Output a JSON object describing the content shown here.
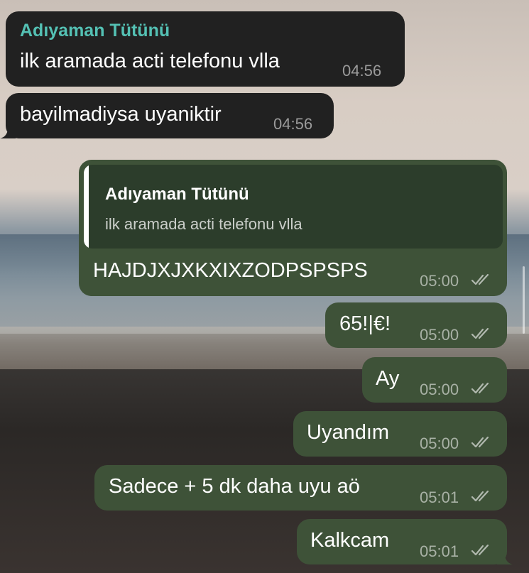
{
  "colors": {
    "incoming_bubble": "#212121",
    "outgoing_bubble": "#3e5238",
    "sender_name": "#54c1b4",
    "reply_quote": "#2c3d2b"
  },
  "messages": [
    {
      "direction": "incoming",
      "sender": "Adıyaman Tütünü",
      "text": "ilk aramada acti telefonu vlla",
      "time": "04:56"
    },
    {
      "direction": "incoming",
      "text": "bayilmadiysa uyaniktir",
      "time": "04:56"
    },
    {
      "direction": "outgoing",
      "reply_to": {
        "sender": "Adıyaman Tütünü",
        "text": "ilk aramada acti telefonu vlla"
      },
      "text": "HAJDJXJXKXIXZODPSPSPS",
      "time": "05:00",
      "status_icon": "double-check-icon"
    },
    {
      "direction": "outgoing",
      "text": "65!|€!",
      "time": "05:00",
      "status_icon": "double-check-icon"
    },
    {
      "direction": "outgoing",
      "text": "Ay",
      "time": "05:00",
      "status_icon": "double-check-icon"
    },
    {
      "direction": "outgoing",
      "text": "Uyandım",
      "time": "05:00",
      "status_icon": "double-check-icon"
    },
    {
      "direction": "outgoing",
      "text": "Sadece + 5 dk daha uyu aö",
      "time": "05:01",
      "status_icon": "double-check-icon"
    },
    {
      "direction": "outgoing",
      "text": "Kalkcam",
      "time": "05:01",
      "status_icon": "double-check-icon"
    }
  ]
}
